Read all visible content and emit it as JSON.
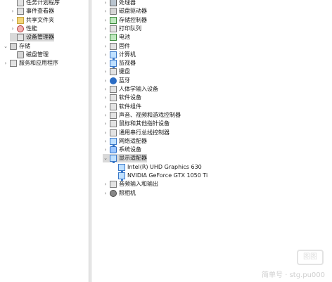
{
  "left_tree": [
    {
      "label": "任务计划程序",
      "indent": 1,
      "icon": "clock-icon",
      "expander": "",
      "selected": false
    },
    {
      "label": "事件查看器",
      "indent": 1,
      "icon": "event-viewer-icon",
      "expander": "›",
      "selected": false
    },
    {
      "label": "共享文件夹",
      "indent": 1,
      "icon": "shared-folder-icon",
      "expander": "›",
      "selected": false
    },
    {
      "label": "性能",
      "indent": 1,
      "icon": "performance-icon",
      "expander": "›",
      "selected": false
    },
    {
      "label": "设备管理器",
      "indent": 1,
      "icon": "device-manager-icon",
      "expander": "",
      "selected": true
    },
    {
      "label": "存储",
      "indent": 0,
      "icon": "storage-icon",
      "expander": "⌄",
      "selected": false
    },
    {
      "label": "磁盘管理",
      "indent": 1,
      "icon": "disk-management-icon",
      "expander": "",
      "selected": false
    },
    {
      "label": "服务和应用程序",
      "indent": 0,
      "icon": "services-icon",
      "expander": "›",
      "selected": false
    }
  ],
  "device_tree": [
    {
      "label": "处理器",
      "indent": 0,
      "icon": "processor-icon",
      "expander": "›"
    },
    {
      "label": "磁盘驱动器",
      "indent": 0,
      "icon": "disk-drive-icon",
      "expander": "›"
    },
    {
      "label": "存储控制器",
      "indent": 0,
      "icon": "storage-controller-icon",
      "expander": "›"
    },
    {
      "label": "打印队列",
      "indent": 0,
      "icon": "printer-icon",
      "expander": "›"
    },
    {
      "label": "电池",
      "indent": 0,
      "icon": "battery-icon",
      "expander": "›"
    },
    {
      "label": "固件",
      "indent": 0,
      "icon": "firmware-icon",
      "expander": "›"
    },
    {
      "label": "计算机",
      "indent": 0,
      "icon": "computer-icon",
      "expander": "›"
    },
    {
      "label": "监视器",
      "indent": 0,
      "icon": "monitor-icon",
      "expander": "›"
    },
    {
      "label": "键盘",
      "indent": 0,
      "icon": "keyboard-icon",
      "expander": "›"
    },
    {
      "label": "蓝牙",
      "indent": 0,
      "icon": "bluetooth-icon",
      "expander": "›"
    },
    {
      "label": "人体学输入设备",
      "indent": 0,
      "icon": "hid-icon",
      "expander": "›"
    },
    {
      "label": "软件设备",
      "indent": 0,
      "icon": "software-device-icon",
      "expander": "›"
    },
    {
      "label": "软件组件",
      "indent": 0,
      "icon": "software-component-icon",
      "expander": "›"
    },
    {
      "label": "声音、视频和游戏控制器",
      "indent": 0,
      "icon": "sound-icon",
      "expander": "›"
    },
    {
      "label": "鼠标和其他指针设备",
      "indent": 0,
      "icon": "mouse-icon",
      "expander": "›"
    },
    {
      "label": "通用串行总线控制器",
      "indent": 0,
      "icon": "usb-icon",
      "expander": "›"
    },
    {
      "label": "网络适配器",
      "indent": 0,
      "icon": "network-adapter-icon",
      "expander": "›"
    },
    {
      "label": "系统设备",
      "indent": 0,
      "icon": "system-device-icon",
      "expander": "›"
    },
    {
      "label": "显示适配器",
      "indent": 0,
      "icon": "display-adapter-icon",
      "expander": "⌄",
      "selected": true
    },
    {
      "label": "Intel(R) UHD Graphics 630",
      "indent": 1,
      "icon": "display-adapter-icon",
      "expander": ""
    },
    {
      "label": "NVIDIA GeForce GTX 1050 Ti",
      "indent": 1,
      "icon": "display-adapter-icon",
      "expander": ""
    },
    {
      "label": "音频输入和输出",
      "indent": 0,
      "icon": "audio-io-icon",
      "expander": "›"
    },
    {
      "label": "照相机",
      "indent": 0,
      "icon": "camera-icon",
      "expander": "›"
    }
  ],
  "watermark": {
    "badge": "图图",
    "text": "简单号 · stg.pu000"
  }
}
